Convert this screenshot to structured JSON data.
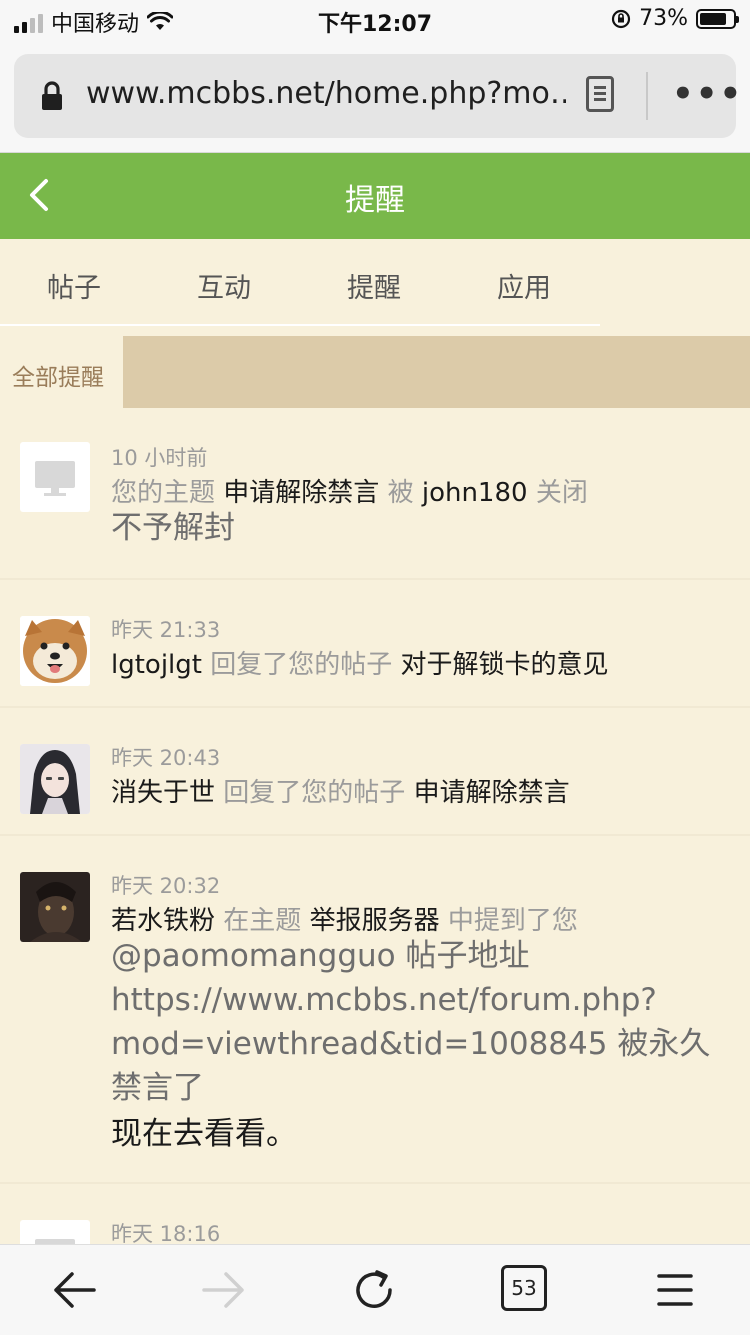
{
  "statusbar": {
    "carrier": "中国移动",
    "time": "下午12:07",
    "battery": "73%",
    "battery_level": 0.73
  },
  "browser": {
    "url": "www.mcbbs.net/home.php?mo…",
    "tabs_count": "53"
  },
  "header": {
    "title": "提醒"
  },
  "tabs": [
    {
      "label": "帖子"
    },
    {
      "label": "互动"
    },
    {
      "label": "提醒"
    },
    {
      "label": "应用"
    }
  ],
  "filter": {
    "label": "全部提醒"
  },
  "notifications": [
    {
      "time": "10 小时前",
      "p1": "您的主题",
      "p2": "申请解除禁言",
      "p3": "被",
      "p4": "john180",
      "p5": "关闭",
      "note": "不予解封",
      "avatar": "monitor-icon"
    },
    {
      "time": "昨天 21:33",
      "user": "lgtojlgt",
      "action": "回复了您的帖子",
      "subject": "对于解锁卡的意见",
      "avatar": "shiba-dog-avatar"
    },
    {
      "time": "昨天 20:43",
      "user": "消失于世",
      "action": "回复了您的帖子",
      "subject": "申请解除禁言",
      "avatar": "anime-girl-avatar"
    },
    {
      "time": "昨天 20:32",
      "user": "若水铁粉",
      "prefix": "在主题",
      "subject": "举报服务器",
      "suffix": "中提到了您",
      "body1": "@paomomangguo 帖子地址",
      "body2": "https://www.mcbbs.net/forum.php?",
      "body3": "mod=viewthread&tid=1008845 被永久",
      "body4": "禁言了",
      "cta": "现在去看看。",
      "avatar": "dark-character-avatar"
    },
    {
      "time": "昨天 18:16",
      "avatar": "monitor-icon"
    }
  ]
}
